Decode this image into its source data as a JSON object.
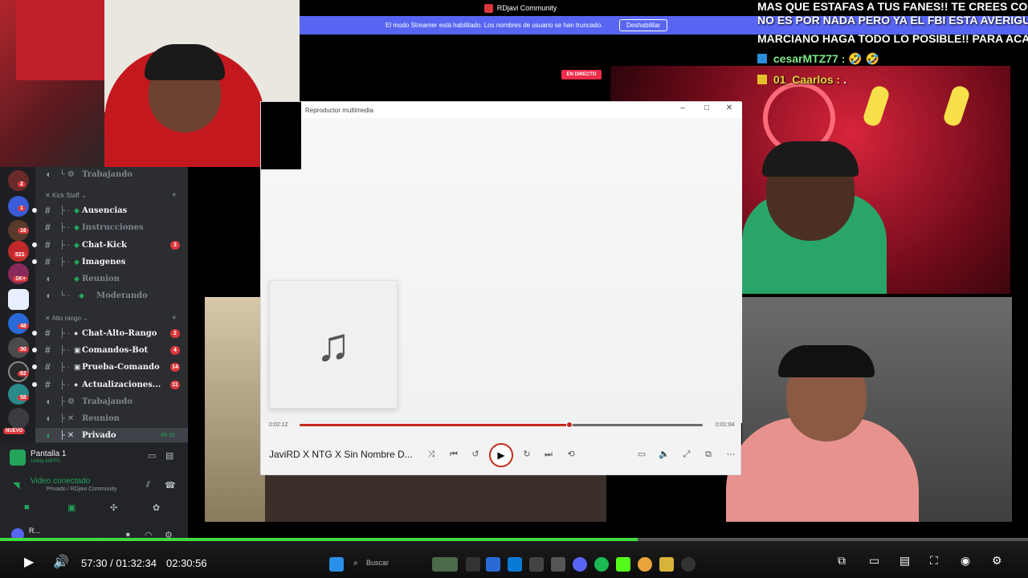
{
  "stream_top": {
    "title": "RDjavi Community"
  },
  "banner": {
    "text": "El modo Streamer está habilitado. Los nombres de usuario se han truncado.",
    "button": "Deshabilitar"
  },
  "chat": [
    {
      "text": "MAS QUE ESTAFAS A TUS FANES!! TE CREES COOL HA"
    },
    {
      "text": "NO ES POR NADA PERO YA EL FBI ESTA AVERIGUAND"
    },
    {
      "text": "MARCIANO HAGA TODO LO POSIBLE!! PARA ACABAR"
    },
    {
      "user": "cesarMTZ77 :",
      "text": "🤣 🤣",
      "user_color": "#7ee787"
    },
    {
      "user": "01_Caarlos :",
      "text": ".",
      "user_color": "#e6d33a"
    }
  ],
  "live_badge": "EN DIRECTO",
  "discord": {
    "server_badges": [
      "2",
      "1",
      "16",
      "521",
      "1K+",
      "48",
      "30",
      "62",
      "58"
    ],
    "new_label": "NUEVO",
    "top_channel": "Trabajando",
    "categories": [
      {
        "name": "Kick Staff"
      },
      {
        "name": "Alto rango"
      }
    ],
    "kick_staff": [
      {
        "label": "Ausencias",
        "active": true,
        "badge": ""
      },
      {
        "label": "Instrucciones",
        "active": false,
        "badge": ""
      },
      {
        "label": "Chat-Kick",
        "active": true,
        "badge": "3"
      },
      {
        "label": "Imagenes",
        "active": true,
        "badge": ""
      },
      {
        "label": "Reunion",
        "active": false,
        "badge": ""
      },
      {
        "label": "Moderando",
        "active": false,
        "badge": ""
      }
    ],
    "alto_rango": [
      {
        "label": "Chat-Alto-Rango",
        "active": true,
        "badge": "2"
      },
      {
        "label": "Comandos-Bot",
        "active": true,
        "badge": "4"
      },
      {
        "label": "Prueba-Comando",
        "active": true,
        "badge": "14"
      },
      {
        "label": "Actualizaciones...",
        "active": true,
        "badge": "11"
      },
      {
        "label": "Trabajando",
        "active": false,
        "badge": ""
      },
      {
        "label": "Reunion",
        "active": false,
        "badge": ""
      },
      {
        "label": "Privado",
        "active": true,
        "badge": "",
        "time": "46:10"
      }
    ],
    "voice": {
      "screen_title": "Pantalla 1",
      "screen_sub": "1440p 60FPS",
      "status": "Video conectado",
      "location": "Privado / RDjavi Community",
      "user": "R..."
    }
  },
  "media_player": {
    "title": "Reproductor multimedia",
    "song": "JaviRD X NTG X Sin Nombre D...",
    "elapsed": "0:02:12",
    "remaining": "0:01:04",
    "progress": 0.67
  },
  "video_player": {
    "current": "57:30",
    "duration": "01:32:34",
    "live_time": "02:30:56",
    "progress": 0.62,
    "buffered": 0.62,
    "search_label": "Buscar"
  },
  "colors": {
    "discord_blurple": "#5865f2",
    "player_accent": "#c42b1c",
    "progress_green": "#3ddc3d",
    "live_red": "#ed2c49"
  }
}
